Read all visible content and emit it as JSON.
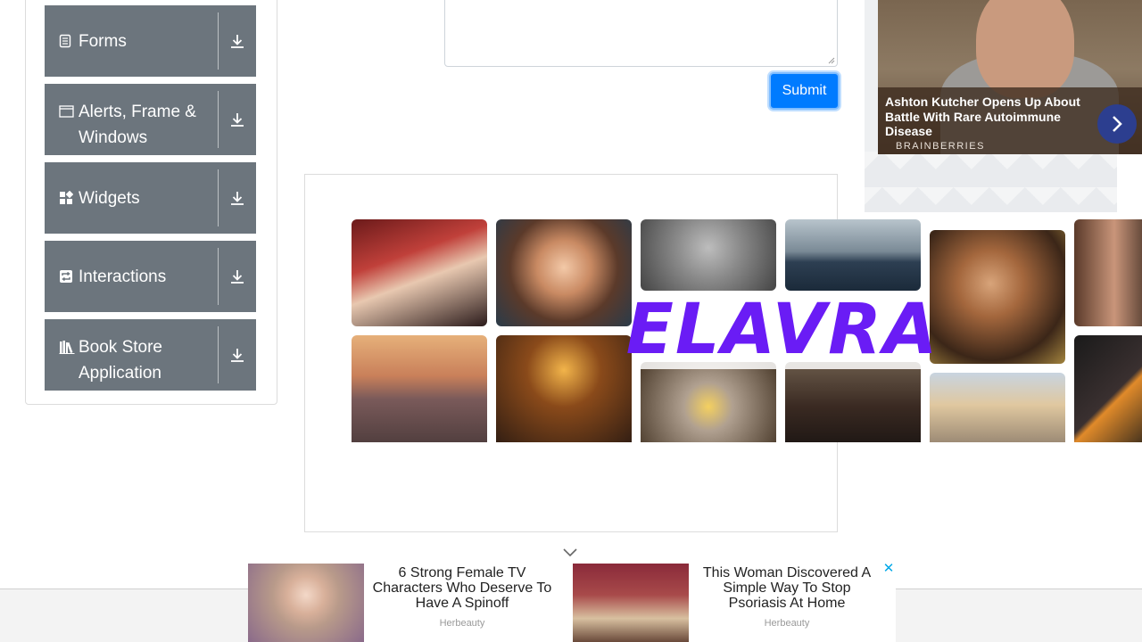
{
  "sidebar": {
    "groups": [
      {
        "label": "Forms",
        "icon": "form-icon"
      },
      {
        "label": "Alerts, Frame &",
        "label2": "Windows",
        "icon": "window-icon"
      },
      {
        "label": "Widgets",
        "icon": "widgets-icon"
      },
      {
        "label": "Interactions",
        "icon": "interactions-icon"
      },
      {
        "label": "Book Store",
        "label2": "Application",
        "icon": "books-icon"
      }
    ]
  },
  "form": {
    "submit_label": "Submit"
  },
  "ad_top": {
    "headline": "Ashton Kutcher Opens Up About Battle With Rare Autoimmune Disease",
    "brand": "BRAINBERRIES"
  },
  "banner": {
    "brand": "ELAVRA"
  },
  "bottom_ad": {
    "items": [
      {
        "title": "6 Strong Female TV Characters Who Deserve To Have A Spinoff",
        "source": "Herbeauty"
      },
      {
        "title": "This Woman Discovered A Simple Way To Stop Psoriasis At Home",
        "source": "Herbeauty"
      }
    ],
    "close_glyph": "✕"
  },
  "colors": {
    "accent": "#007bff",
    "sidebar_group": "#6c757d",
    "banner_brand": "#6a1cf5",
    "ad_next": "#2c3e8f"
  }
}
